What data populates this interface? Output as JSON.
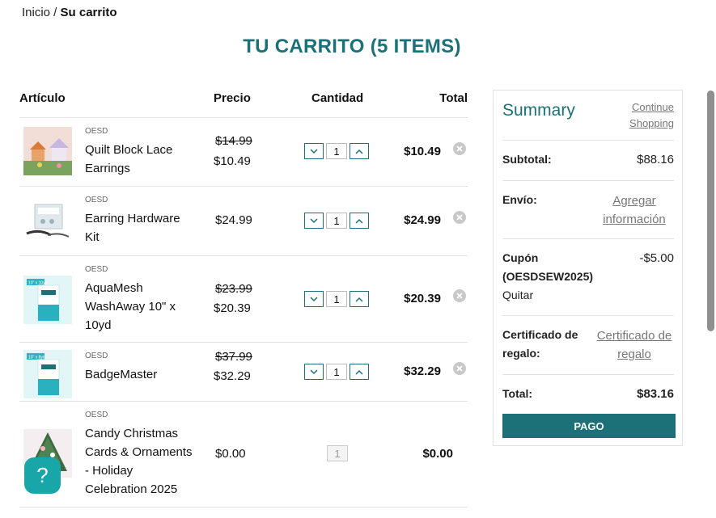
{
  "breadcrumb": {
    "home": "Inicio /",
    "current": "Su carrito"
  },
  "page_title": "TU CARRITO (5 ITEMS)",
  "table_headers": {
    "item": "Artículo",
    "price": "Precio",
    "quantity": "Cantidad",
    "total": "Total"
  },
  "items": [
    {
      "brand": "OESD",
      "name": "Quilt Block Lace Earrings",
      "old_price": "$14.99",
      "price": "$10.49",
      "qty": "1",
      "total": "$10.49",
      "image": "earrings-photo"
    },
    {
      "brand": "OESD",
      "name": "Earring Hardware Kit",
      "old_price": "",
      "price": "$24.99",
      "qty": "1",
      "total": "$24.99",
      "image": "hardware-kit-photo"
    },
    {
      "brand": "OESD",
      "name": "AquaMesh WashAway 10\" x 10yd",
      "old_price": "$23.99",
      "price": "$20.39",
      "qty": "1",
      "total": "$20.39",
      "image": "aquamesh-roll-photo",
      "badge": "10\" x 10yd"
    },
    {
      "brand": "OESD",
      "name": "BadgeMaster",
      "old_price": "$37.99",
      "price": "$32.29",
      "qty": "1",
      "total": "$32.29",
      "image": "badgemaster-roll-photo",
      "badge": "10\" x 8yd"
    },
    {
      "brand": "OESD",
      "name": "Candy Christmas Cards & Ornaments - Holiday Celebration 2025",
      "old_price": "",
      "price": "$0.00",
      "qty": "1",
      "total": "$0.00",
      "image": "christmas-tree-photo"
    }
  ],
  "summary": {
    "title": "Summary",
    "continue_shopping": "Continue Shopping",
    "subtotal_label": "Subtotal:",
    "subtotal_value": "$88.16",
    "shipping_label": "Envío:",
    "shipping_link": "Agregar información",
    "coupon_label": "Cupón (OESDSEW2025)",
    "coupon_value": "-$5.00",
    "coupon_remove": "Quitar",
    "gift_label": "Certificado de regalo:",
    "gift_link": "Certificado de regalo",
    "total_label": "Total:",
    "total_value": "$83.16",
    "checkout_label": "PAGO"
  },
  "help_label": "?",
  "colors": {
    "accent": "#1b7177",
    "help": "#19a6a8"
  }
}
